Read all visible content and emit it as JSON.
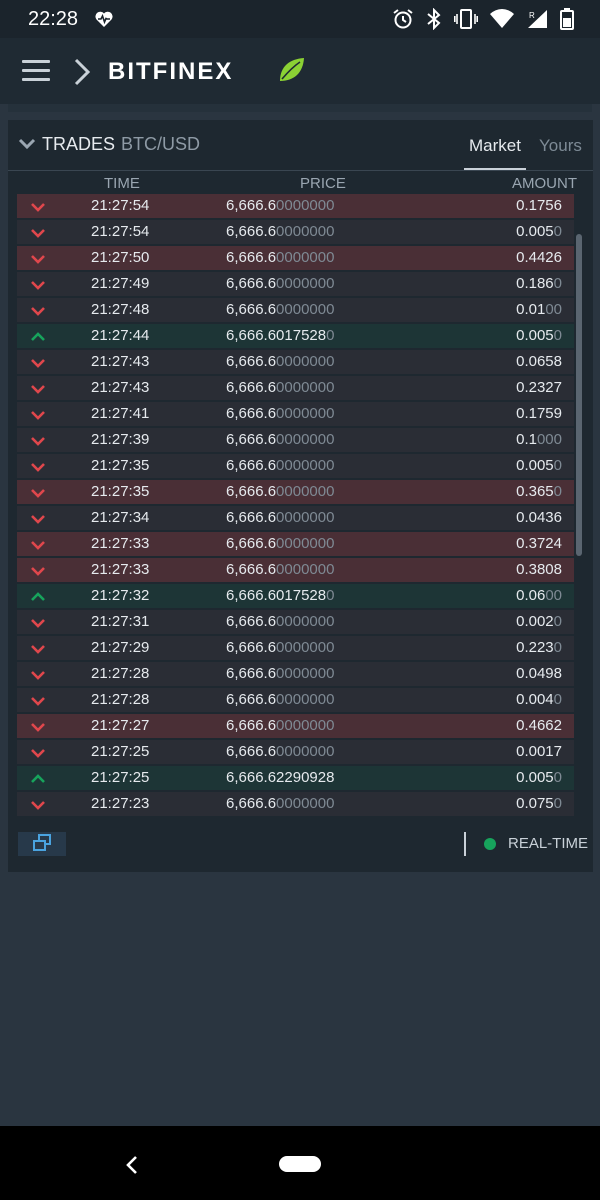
{
  "status_bar": {
    "time": "22:28",
    "icons": [
      "heart-monitor-icon",
      "alarm-icon",
      "bluetooth-icon",
      "vibrate-icon",
      "wifi-icon",
      "signal-icon",
      "battery-icon"
    ]
  },
  "nav": {
    "brand": "BITFINEX",
    "icons": [
      "hamburger-menu-icon",
      "chevron-right-icon",
      "leaf-logo-icon"
    ]
  },
  "panel": {
    "title": "TRADES",
    "pair": "BTC/USD",
    "tabs": [
      {
        "label": "Market",
        "active": true
      },
      {
        "label": "Yours",
        "active": false
      }
    ],
    "columns": {
      "time": "TIME",
      "price": "PRICE",
      "amount": "AMOUNT"
    },
    "trades": [
      {
        "side": "sell",
        "bg": "strong",
        "time": "21:27:54",
        "price_main": "6,666.6",
        "price_dim": "0000000",
        "amount_main": "0.1756",
        "amount_dim": ""
      },
      {
        "side": "sell",
        "bg": "light",
        "time": "21:27:54",
        "price_main": "6,666.6",
        "price_dim": "0000000",
        "amount_main": "0.005",
        "amount_dim": "0"
      },
      {
        "side": "sell",
        "bg": "strong",
        "time": "21:27:50",
        "price_main": "6,666.6",
        "price_dim": "0000000",
        "amount_main": "0.4426",
        "amount_dim": ""
      },
      {
        "side": "sell",
        "bg": "light",
        "time": "21:27:49",
        "price_main": "6,666.6",
        "price_dim": "0000000",
        "amount_main": "0.186",
        "amount_dim": "0"
      },
      {
        "side": "sell",
        "bg": "light",
        "time": "21:27:48",
        "price_main": "6,666.6",
        "price_dim": "0000000",
        "amount_main": "0.01",
        "amount_dim": "00"
      },
      {
        "side": "buy",
        "bg": "buy",
        "time": "21:27:44",
        "price_main": "6,666.6017528",
        "price_dim": "0",
        "amount_main": "0.005",
        "amount_dim": "0"
      },
      {
        "side": "sell",
        "bg": "light",
        "time": "21:27:43",
        "price_main": "6,666.6",
        "price_dim": "0000000",
        "amount_main": "0.0658",
        "amount_dim": ""
      },
      {
        "side": "sell",
        "bg": "light",
        "time": "21:27:43",
        "price_main": "6,666.6",
        "price_dim": "0000000",
        "amount_main": "0.2327",
        "amount_dim": ""
      },
      {
        "side": "sell",
        "bg": "light",
        "time": "21:27:41",
        "price_main": "6,666.6",
        "price_dim": "0000000",
        "amount_main": "0.1759",
        "amount_dim": ""
      },
      {
        "side": "sell",
        "bg": "light",
        "time": "21:27:39",
        "price_main": "6,666.6",
        "price_dim": "0000000",
        "amount_main": "0.1",
        "amount_dim": "000"
      },
      {
        "side": "sell",
        "bg": "light",
        "time": "21:27:35",
        "price_main": "6,666.6",
        "price_dim": "0000000",
        "amount_main": "0.005",
        "amount_dim": "0"
      },
      {
        "side": "sell",
        "bg": "strong",
        "time": "21:27:35",
        "price_main": "6,666.6",
        "price_dim": "0000000",
        "amount_main": "0.365",
        "amount_dim": "0"
      },
      {
        "side": "sell",
        "bg": "light",
        "time": "21:27:34",
        "price_main": "6,666.6",
        "price_dim": "0000000",
        "amount_main": "0.0436",
        "amount_dim": ""
      },
      {
        "side": "sell",
        "bg": "strong",
        "time": "21:27:33",
        "price_main": "6,666.6",
        "price_dim": "0000000",
        "amount_main": "0.3724",
        "amount_dim": ""
      },
      {
        "side": "sell",
        "bg": "strong",
        "time": "21:27:33",
        "price_main": "6,666.6",
        "price_dim": "0000000",
        "amount_main": "0.3808",
        "amount_dim": ""
      },
      {
        "side": "buy",
        "bg": "buy",
        "time": "21:27:32",
        "price_main": "6,666.6017528",
        "price_dim": "0",
        "amount_main": "0.06",
        "amount_dim": "00"
      },
      {
        "side": "sell",
        "bg": "light",
        "time": "21:27:31",
        "price_main": "6,666.6",
        "price_dim": "0000000",
        "amount_main": "0.002",
        "amount_dim": "0"
      },
      {
        "side": "sell",
        "bg": "light",
        "time": "21:27:29",
        "price_main": "6,666.6",
        "price_dim": "0000000",
        "amount_main": "0.223",
        "amount_dim": "0"
      },
      {
        "side": "sell",
        "bg": "light",
        "time": "21:27:28",
        "price_main": "6,666.6",
        "price_dim": "0000000",
        "amount_main": "0.0498",
        "amount_dim": ""
      },
      {
        "side": "sell",
        "bg": "light",
        "time": "21:27:28",
        "price_main": "6,666.6",
        "price_dim": "0000000",
        "amount_main": "0.004",
        "amount_dim": "0"
      },
      {
        "side": "sell",
        "bg": "strong",
        "time": "21:27:27",
        "price_main": "6,666.6",
        "price_dim": "0000000",
        "amount_main": "0.4662",
        "amount_dim": ""
      },
      {
        "side": "sell",
        "bg": "light",
        "time": "21:27:25",
        "price_main": "6,666.6",
        "price_dim": "0000000",
        "amount_main": "0.0017",
        "amount_dim": ""
      },
      {
        "side": "buy",
        "bg": "buy",
        "time": "21:27:25",
        "price_main": "6,666.62290928",
        "price_dim": "",
        "amount_main": "0.005",
        "amount_dim": "0"
      },
      {
        "side": "sell",
        "bg": "light",
        "time": "21:27:23",
        "price_main": "6,666.6",
        "price_dim": "0000000",
        "amount_main": "0.075",
        "amount_dim": "0"
      }
    ],
    "footer": {
      "realtime_label": "REAL-TIME"
    }
  },
  "colors": {
    "sell_arrow": "#e0474c",
    "buy_arrow": "#17a35c",
    "realtime_dot": "#17a35c",
    "brand_leaf": "#8bd134"
  }
}
